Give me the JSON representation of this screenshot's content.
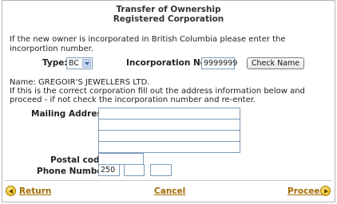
{
  "header": {
    "title_line1": "Transfer of Ownership",
    "title_line2": "Registered Corporation"
  },
  "intro_text": "If the new owner is incorporated in British Columbia please enter the incorportion number.",
  "type_label": "Type:",
  "type_selected": "BC",
  "incorp_label": "Incorporation No.:",
  "incorp_value": "9999999",
  "check_button": "Check Name",
  "name_line": "Name: GREGOIR'S JEWELLERS LTD.",
  "confirm_text": "If this is the correct corporation fill out the address information below and proceed - if not check the incorporation number and re-enter.",
  "mailing_label": "Mailing Address:",
  "mailing_lines": [
    "",
    "",
    "",
    ""
  ],
  "postal_label": "Postal code:",
  "postal_value": "",
  "phone_label": "Phone Number:",
  "phone_area": "250",
  "phone_prefix": "",
  "phone_line": "",
  "nav": {
    "return": "Return",
    "cancel": "Cancel",
    "proceed": "Proceed"
  },
  "icons": {
    "return": "left-arrow-circle-icon",
    "proceed": "right-arrow-circle-icon"
  },
  "colors": {
    "link": "#a26a00",
    "input_border": "#7f9db9"
  }
}
